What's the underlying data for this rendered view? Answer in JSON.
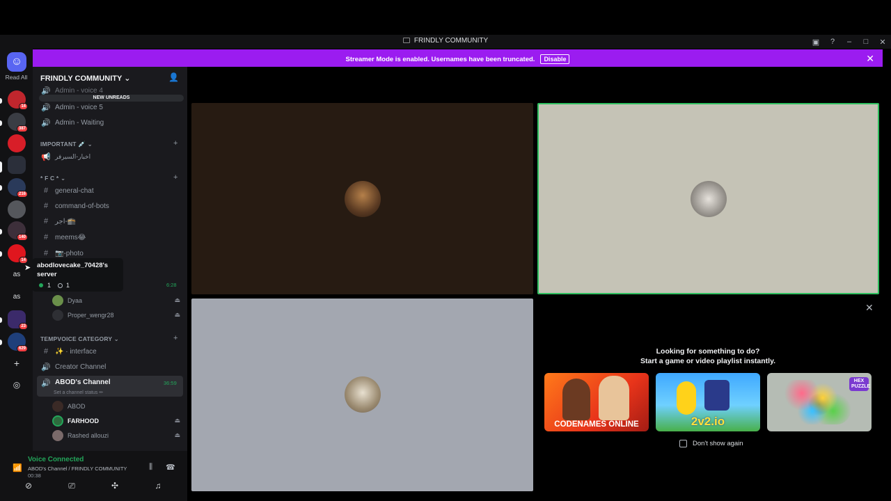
{
  "window": {
    "title": "FRINDLY COMMUNITY"
  },
  "banner": {
    "message": "Streamer Mode is enabled. Usernames have been truncated.",
    "button": "Disable"
  },
  "rail": {
    "read_all": "Read All",
    "badges": [
      "14",
      "387",
      "216",
      "140",
      "14",
      "23",
      "629"
    ],
    "text_servers": [
      "as",
      "as"
    ]
  },
  "server": {
    "name": "FRINDLY COMMUNITY"
  },
  "new_unreads": "NEW UNREADS",
  "channels": {
    "admin_voice4": "Admin - voice 4",
    "admin_voice5": "Admin - voice 5",
    "admin_waiting": "Admin - Waiting",
    "important_cat": "IMPORTANT 💉",
    "news": "اخبار-السيرفر",
    "fc_cat": "* F C *",
    "general": "general-chat",
    "command": "command-of-bots",
    "ajr": "اجر-🕋",
    "meems": "meems😂",
    "photo": "📷-photo",
    "tempvoice_cat": "TEMPVOICE CATEGORY",
    "interface": "✨ · interface",
    "creator": "Creator Channel",
    "abod_channel": "ABOD's Channel",
    "abod_status": "Set a channel status ✏"
  },
  "voice_users_top": [
    "Dyaa",
    "Proper_wengr28"
  ],
  "voice_users_abod": [
    "ABOD",
    "FARHOOD",
    "Rashed allouzi"
  ],
  "timers": {
    "top": "6:28",
    "abod": "36:59"
  },
  "tooltip": {
    "name": "abodlovecake_70428's server",
    "online": "1",
    "members": "1"
  },
  "voice": {
    "status": "Voice Connected",
    "channel": "ABOD's Channel / FRINDLY COMMUNITY",
    "elapsed": "00:38"
  },
  "activity": {
    "title_line1": "Looking for something to do?",
    "title_line2": "Start a game or video playlist instantly.",
    "games": [
      "CODENAMES ONLINE",
      "2v2.io",
      "HEX PUZZLE"
    ],
    "dont_show": "Don't show again"
  }
}
